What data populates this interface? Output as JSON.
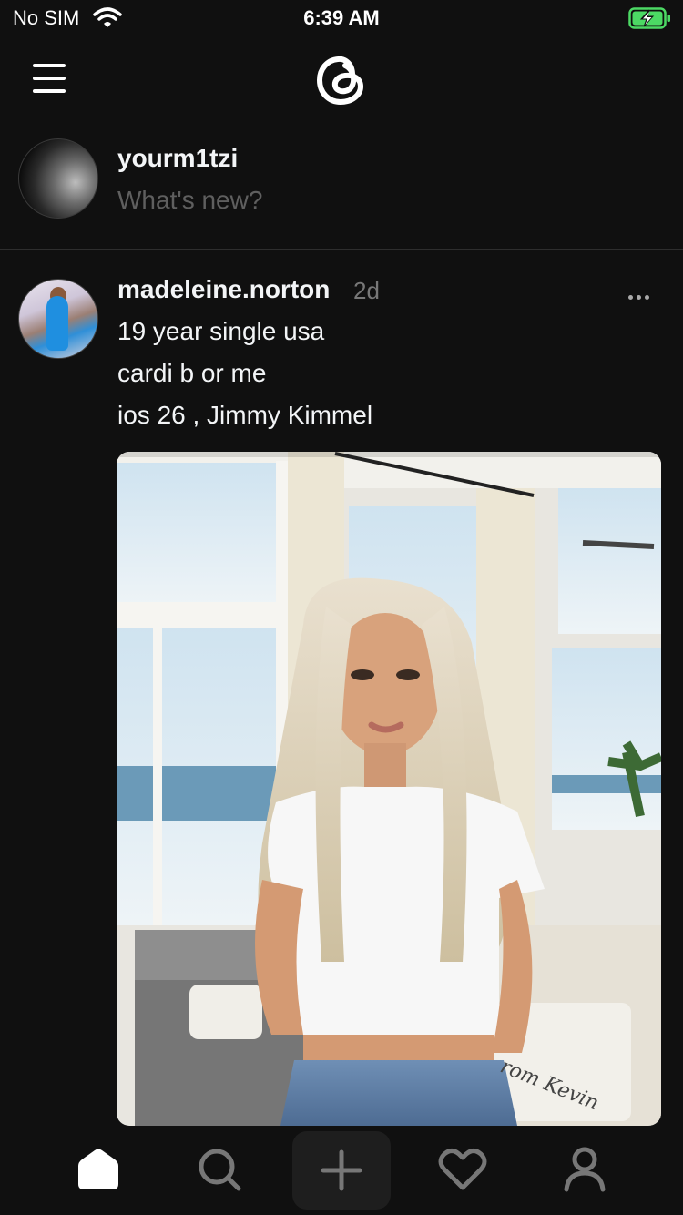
{
  "status": {
    "carrier": "No SIM",
    "time": "6:39 AM",
    "battery_color": "#4cd964"
  },
  "header": {
    "logo": "threads-logo",
    "menu_icon": "hamburger-icon"
  },
  "composer": {
    "username": "yourm1tzi",
    "prompt": "What's new?"
  },
  "post": {
    "username": "madeleine.norton",
    "time": "2d",
    "lines": [
      "19 year single usa",
      "cardi b or me",
      "ios 26 , Jimmy Kimmel"
    ],
    "image_caption_text": "rom Kevin"
  },
  "tabbar": {
    "items": [
      "home-icon",
      "search-icon",
      "create-icon",
      "heart-icon",
      "profile-icon"
    ]
  }
}
